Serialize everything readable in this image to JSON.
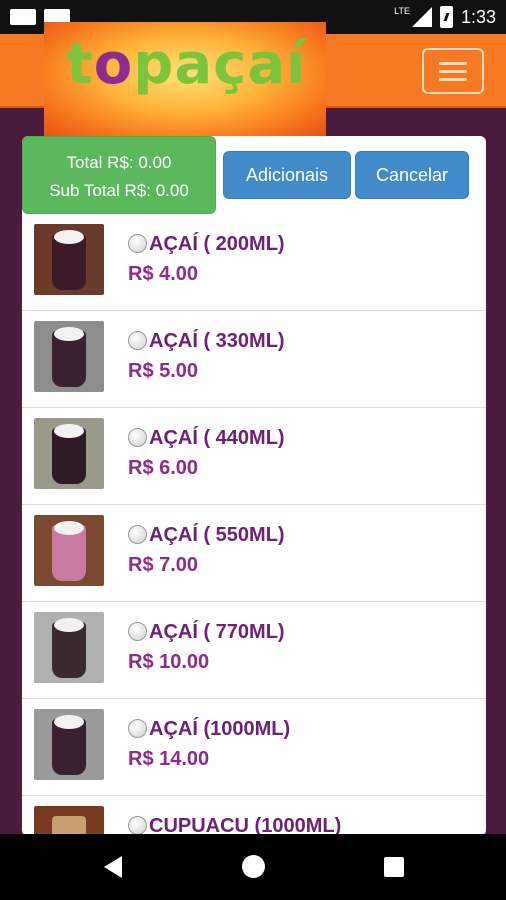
{
  "status_bar": {
    "time": "1:33",
    "network": "LTE"
  },
  "header": {
    "logo_part1": "t",
    "logo_part2": "o",
    "logo_part3": "paçaí",
    "brand_colors": {
      "green": "#7cc43a",
      "purple": "#8e2b8e",
      "orange": "#f57a23"
    }
  },
  "cart": {
    "total_text": "Total R$: 0.00",
    "subtotal_text": "Sub Total R$: 0.00",
    "add_button": "Adicionais",
    "cancel_button": "Cancelar"
  },
  "products": [
    {
      "name": "AÇAÍ ( 200ML)",
      "price": "R$ 4.00",
      "thumb_bg": "#6a3a2a",
      "cup": "#3b1a2a"
    },
    {
      "name": "AÇAÍ ( 330ML)",
      "price": "R$ 5.00",
      "thumb_bg": "#8d8d8d",
      "cup": "#3a2030"
    },
    {
      "name": "AÇAÍ ( 440ML)",
      "price": "R$ 6.00",
      "thumb_bg": "#9a9a8a",
      "cup": "#2f1a28"
    },
    {
      "name": "AÇAÍ ( 550ML)",
      "price": "R$ 7.00",
      "thumb_bg": "#7a4a30",
      "cup": "#c87aa0"
    },
    {
      "name": "AÇAÍ ( 770ML)",
      "price": "R$ 10.00",
      "thumb_bg": "#b0b0b0",
      "cup": "#3a2a30"
    },
    {
      "name": "AÇAÍ (1000ML)",
      "price": "R$ 14.00",
      "thumb_bg": "#9a9a9a",
      "cup": "#3a2030"
    },
    {
      "name": "CUPUACU (1000ML)",
      "price": "",
      "thumb_bg": "#7a3a20",
      "cup": "#c8a070"
    }
  ]
}
